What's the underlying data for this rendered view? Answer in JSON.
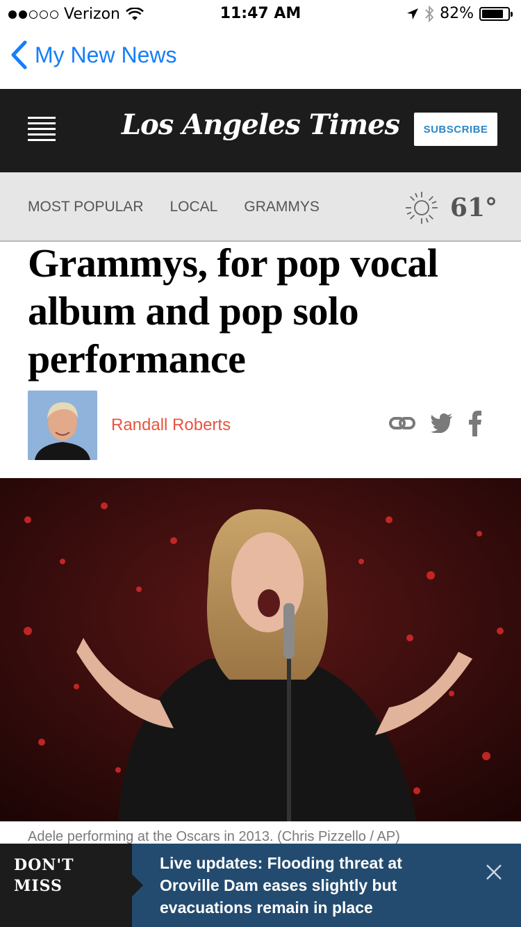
{
  "status_bar": {
    "signal_bars_filled": 2,
    "signal_bars_total": 5,
    "carrier": "Verizon",
    "time": "11:47 AM",
    "battery_percent": "82%",
    "battery_level": 0.82,
    "icons": [
      "wifi-icon",
      "location-arrow-icon",
      "bluetooth-icon",
      "battery-icon"
    ]
  },
  "nav": {
    "back_label": "My New News",
    "accent": "#157efb"
  },
  "masthead": {
    "logo_text": "Los Angeles Times",
    "subscribe_label": "SUBSCRIBE",
    "background": "#1c1c1c"
  },
  "sections": {
    "tabs": [
      "MOST POPULAR",
      "LOCAL",
      "GRAMMYS"
    ],
    "weather_icon": "sun-icon",
    "temperature": "61°"
  },
  "article": {
    "headline": "Grammys, for pop vocal album and pop solo performance",
    "author": "Randall Roberts",
    "author_color": "#e8543f",
    "share_icons": [
      "link-icon",
      "twitter-icon",
      "facebook-icon"
    ],
    "photo_caption": "Adele performing at the Oscars in 2013. (Chris Pizzello / AP)"
  },
  "dont_miss": {
    "label_line1": "DON'T",
    "label_line2": "MISS",
    "headline": "Live updates: Flooding threat at Oroville Dam eases slightly but evacuations remain in place",
    "background": "#234b6f"
  }
}
